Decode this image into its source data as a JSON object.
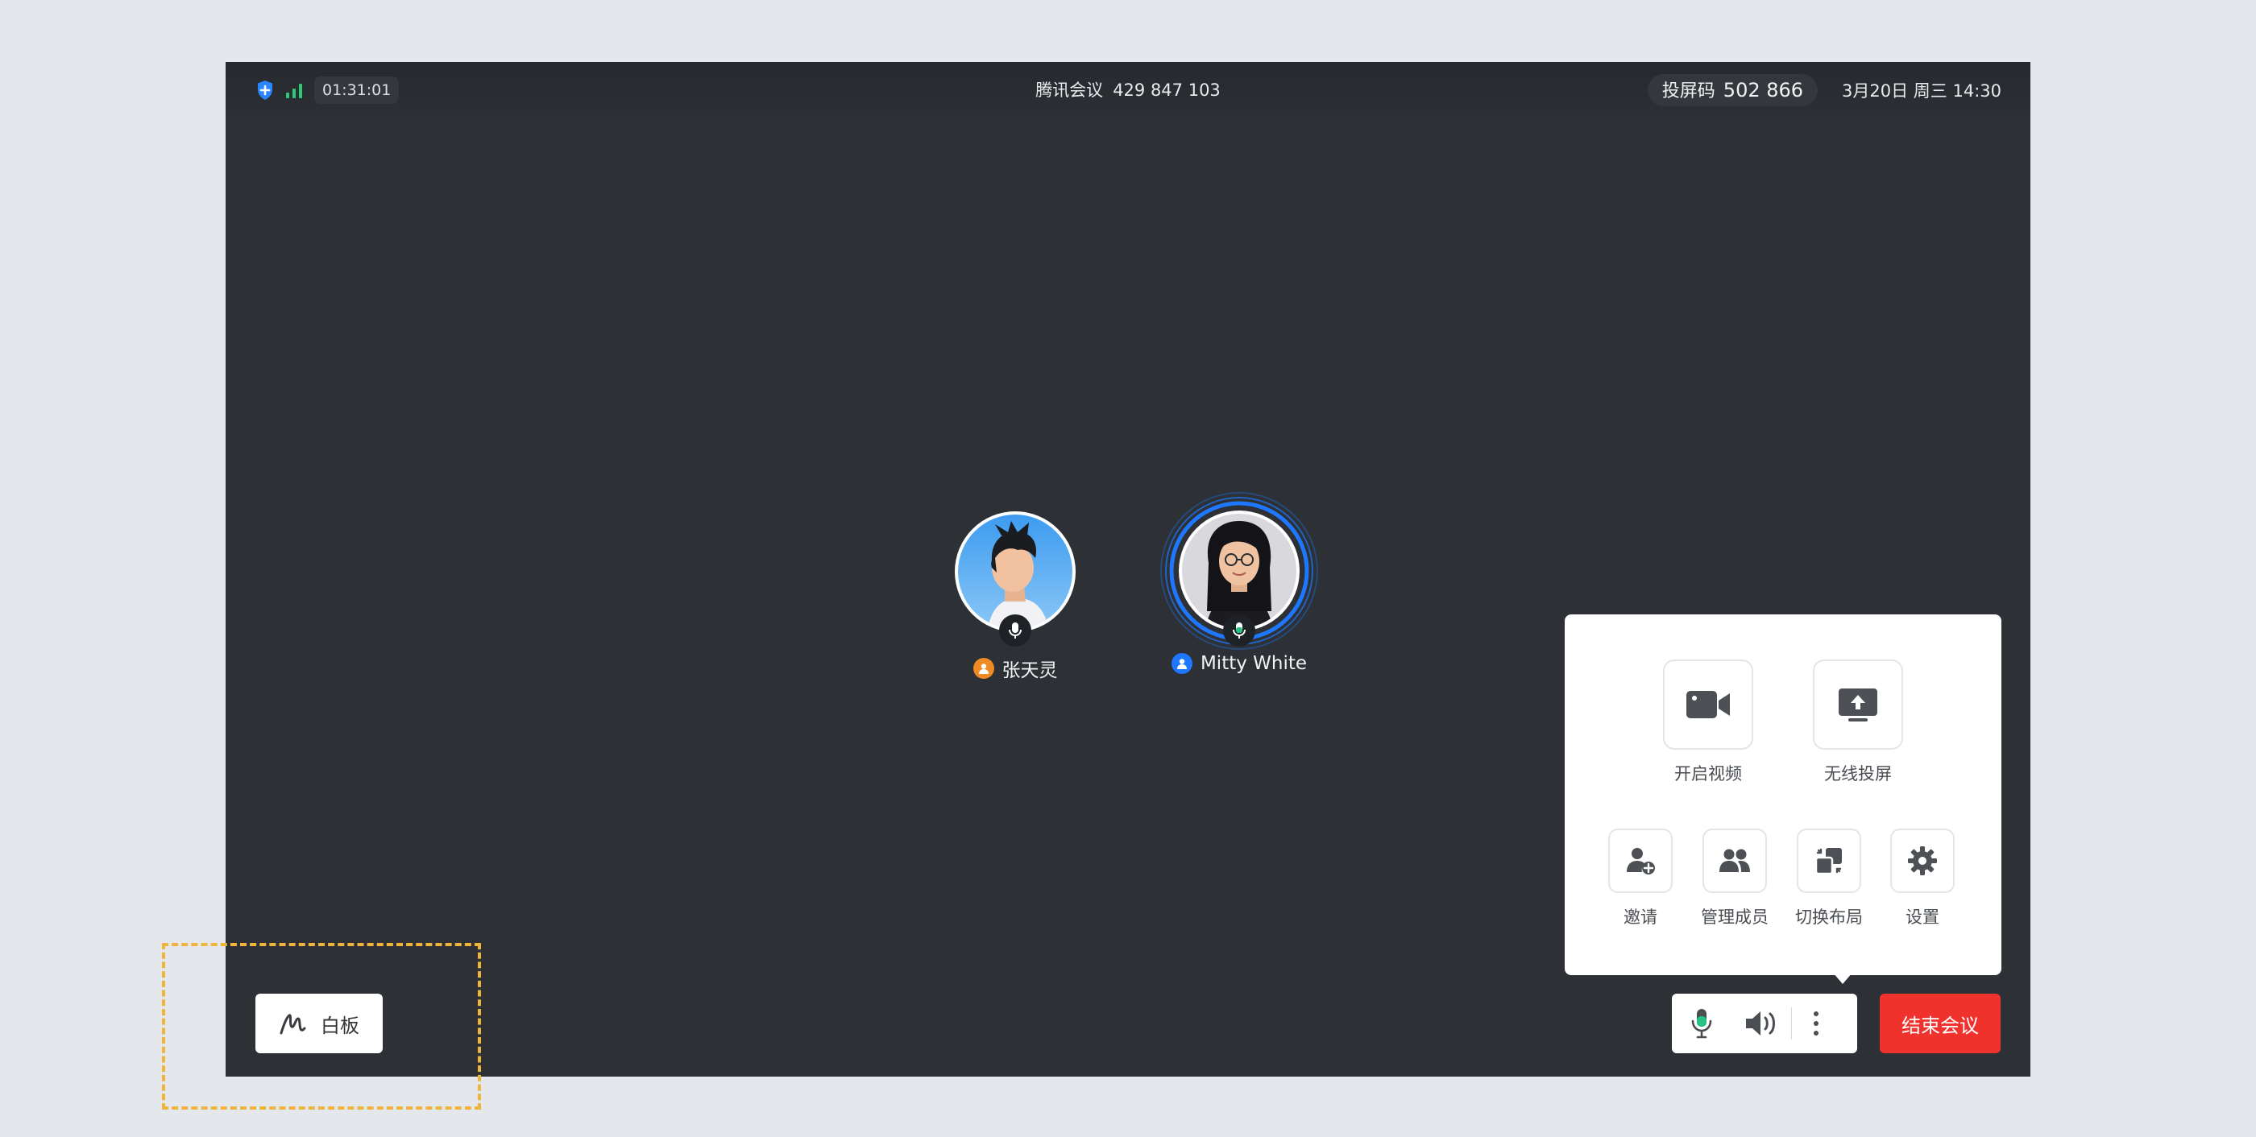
{
  "topbar": {
    "timer": "01:31:01",
    "meeting_app": "腾讯会议",
    "meeting_id": "429 847 103",
    "cast_label": "投屏码",
    "cast_code": "502 866",
    "datetime": "3月20日 周三 14:30"
  },
  "participants": [
    {
      "name": "张天灵",
      "badge_color": "#f08a24",
      "speaking": false
    },
    {
      "name": "Mitty White",
      "badge_color": "#1e78ff",
      "speaking": true
    }
  ],
  "whiteboard": {
    "label": "白板"
  },
  "panel": {
    "primary": [
      {
        "label": "开启视频",
        "icon": "video-camera-icon"
      },
      {
        "label": "无线投屏",
        "icon": "screen-cast-icon"
      }
    ],
    "secondary": [
      {
        "label": "邀请",
        "icon": "invite-user-icon"
      },
      {
        "label": "管理成员",
        "icon": "members-icon"
      },
      {
        "label": "切换布局",
        "icon": "switch-layout-icon"
      },
      {
        "label": "设置",
        "icon": "gear-icon"
      }
    ]
  },
  "controls": {
    "end_label": "结束会议"
  },
  "colors": {
    "background": "#e4e8ed",
    "stage": "#2d3034",
    "accent_blue": "#1e78ff",
    "mic_green": "#26c281",
    "end_red": "#f0322d",
    "highlight": "#f0b43c"
  }
}
